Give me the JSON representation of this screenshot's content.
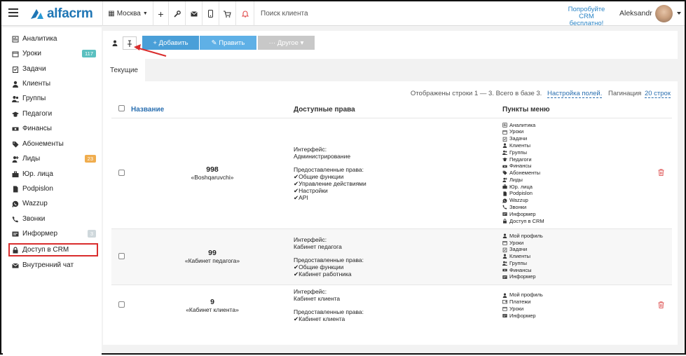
{
  "topbar": {
    "logo_text": "alfacrm",
    "branch": "Москва",
    "search_placeholder": "Поиск клиента",
    "cta_line1": "Попробуйте",
    "cta_line2": "CRM бесплатно!",
    "username": "Aleksandr"
  },
  "sidebar": {
    "items": [
      {
        "label": "Аналитика",
        "icon": "analytics-icon"
      },
      {
        "label": "Уроки",
        "icon": "calendar-icon",
        "badge": "117",
        "badge_color": "#5bc0c0"
      },
      {
        "label": "Задачи",
        "icon": "tasks-icon"
      },
      {
        "label": "Клиенты",
        "icon": "user-icon"
      },
      {
        "label": "Группы",
        "icon": "users-icon"
      },
      {
        "label": "Педагоги",
        "icon": "graduation-cap-icon"
      },
      {
        "label": "Финансы",
        "icon": "money-icon"
      },
      {
        "label": "Абонементы",
        "icon": "tag-icon"
      },
      {
        "label": "Лиды",
        "icon": "lead-icon",
        "badge": "23",
        "badge_color": "#f0ad4e"
      },
      {
        "label": "Юр. лица",
        "icon": "briefcase-icon"
      },
      {
        "label": "Podpislon",
        "icon": "document-icon"
      },
      {
        "label": "Wazzup",
        "icon": "whatsapp-icon"
      },
      {
        "label": "Звонки",
        "icon": "phone-icon"
      },
      {
        "label": "Информер",
        "icon": "informer-icon",
        "badge": "3",
        "badge_color": "#cfd8dc"
      },
      {
        "label": "Доступ в CRM",
        "icon": "lock-icon"
      },
      {
        "label": "Внутренний чат",
        "icon": "envelope-icon"
      }
    ]
  },
  "toolbar": {
    "add_label": "+ Добавить",
    "edit_label": "✎ Править",
    "other_label": "··· Другое ▾",
    "primary_color": "#4a9fd8",
    "light_color": "#5fb0e6",
    "disabled_color": "#c8c8c8"
  },
  "tabs": [
    {
      "label": "Текущие"
    }
  ],
  "info": {
    "rows_text": "Отображены строки 1 — 3. Всего в базе 3.",
    "fields_link": "Настройка полей.",
    "pagination_label": "Пагинация",
    "pagination_link": "20 строк"
  },
  "table": {
    "headers": {
      "name": "Название",
      "rights": "Доступные права",
      "menu": "Пункты меню"
    },
    "rows": [
      {
        "num": "998",
        "name": "«Boshqaruvchi»",
        "interface_label": "Интерфейс:",
        "interface": "Администрирование",
        "rights_label": "Предоставленные права:",
        "rights": [
          "✔Общие функции",
          "✔Управление действиями",
          "✔Настройки",
          "✔API"
        ],
        "menu": [
          "Аналитика",
          "Уроки",
          "Задачи",
          "Клиенты",
          "Группы",
          "Педагоги",
          "Финансы",
          "Абонементы",
          "Лиды",
          "Юр. лица",
          "Podpislon",
          "Wazzup",
          "Звонки",
          "Информер",
          "Доступ в CRM"
        ],
        "deletable": true
      },
      {
        "num": "99",
        "name": "«Кабинет педагога»",
        "interface_label": "Интерфейс:",
        "interface": "Кабинет педагога",
        "rights_label": "Предоставленные права:",
        "rights": [
          "✔Общие функции",
          "✔Кабинет работника"
        ],
        "menu": [
          "Мой профиль",
          "Уроки",
          "Задачи",
          "Клиенты",
          "Группы",
          "Финансы",
          "Информер"
        ],
        "deletable": false
      },
      {
        "num": "9",
        "name": "«Кабинет клиента»",
        "interface_label": "Интерфейс:",
        "interface": "Кабинет клиента",
        "rights_label": "Предоставленные права:",
        "rights": [
          "✔Кабинет клиента"
        ],
        "menu": [
          "Мой профиль",
          "Платежи",
          "Уроки",
          "Информер"
        ],
        "deletable": true
      }
    ]
  },
  "colors": {
    "logo_blue": "#1f76b5",
    "highlight_red": "#d92d2d",
    "link_blue": "#2a6fb0"
  }
}
